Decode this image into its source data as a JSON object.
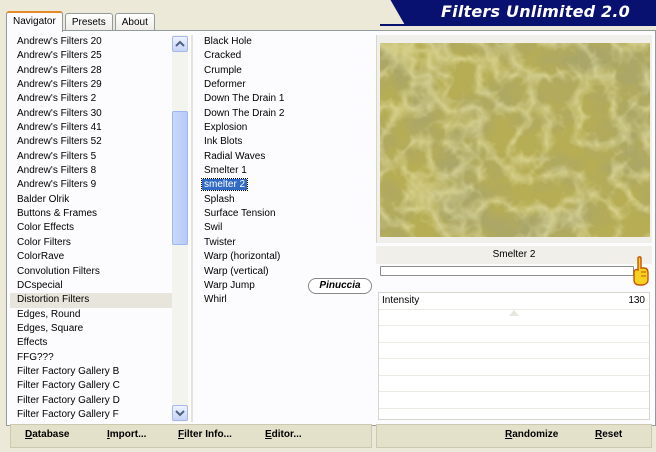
{
  "banner": {
    "title": "Filters Unlimited 2.0"
  },
  "tabs": [
    {
      "label": "Navigator",
      "active": true
    },
    {
      "label": "Presets",
      "active": false
    },
    {
      "label": "About",
      "active": false
    }
  ],
  "categories": [
    "Andrew's Filters 20",
    "Andrew's Filters 25",
    "Andrew's Filters 28",
    "Andrew's Filters 29",
    "Andrew's Filters 2",
    "Andrew's Filters 30",
    "Andrew's Filters 41",
    "Andrew's Filters 52",
    "Andrew's Filters 5",
    "Andrew's Filters 8",
    "Andrew's Filters 9",
    "Balder Olrik",
    "Buttons & Frames",
    "Color Effects",
    "Color Filters",
    "ColorRave",
    "Convolution Filters",
    "DCspecial",
    "Distortion Filters",
    "Edges, Round",
    "Edges, Square",
    "Effects",
    "FFG???",
    "Filter Factory Gallery B",
    "Filter Factory Gallery C",
    "Filter Factory Gallery D",
    "Filter Factory Gallery F"
  ],
  "selected_category": "Distortion Filters",
  "filters": [
    "Black Hole",
    "Cracked",
    "Crumple",
    "Deformer",
    "Down The Drain 1",
    "Down The Drain 2",
    "Explosion",
    "Ink Blots",
    "Radial Waves",
    "Smelter 1",
    "smelter 2",
    "Splash",
    "Surface Tension",
    "Swil",
    "Twister",
    "Warp (horizontal)",
    "Warp (vertical)",
    "Warp Jump",
    "Whirl"
  ],
  "selected_filter": "smelter 2",
  "watermark": "Pinuccia",
  "preview": {
    "filter_name": "Smelter 2"
  },
  "parameters": [
    {
      "label": "Intensity",
      "value": "130",
      "fraction": 1.0
    }
  ],
  "buttons": {
    "database": "Database",
    "import": "Import...",
    "filter_info": "Filter Info...",
    "editor": "Editor...",
    "randomize": "Randomize",
    "reset": "Reset"
  },
  "colors": {
    "banner_bg": "#081070",
    "selection": "#316ac5",
    "preview_base": "#b2a94f"
  },
  "icons": {
    "scroll_up": "chevron-up-icon",
    "scroll_down": "chevron-down-icon",
    "slider_thumb": "pointing-hand-icon"
  }
}
